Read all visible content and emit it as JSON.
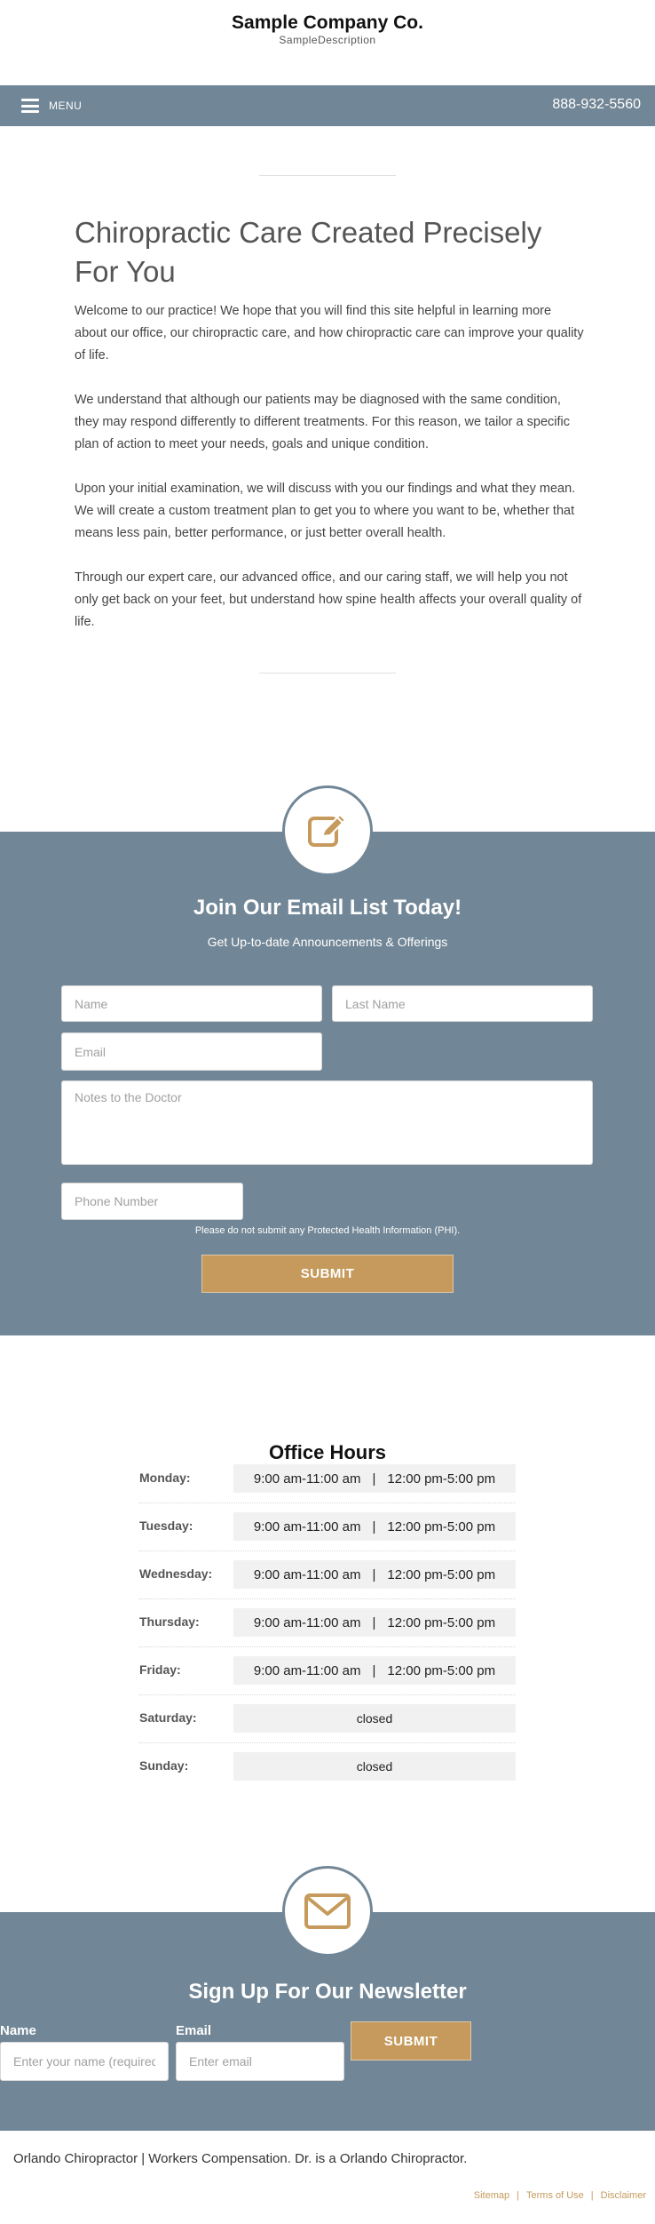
{
  "header": {
    "company_name": "Sample Company Co.",
    "tagline": "SampleDescription"
  },
  "nav": {
    "menu_label": "MENU",
    "phone": "888-932-5560"
  },
  "intro": {
    "title": "Chiropractic Care Created Precisely For You",
    "paragraphs": [
      "Welcome to our practice! We hope that you will find this site helpful in learning more about our office, our chiropractic care, and how chiropractic care can improve your quality of life.",
      "We understand that although our patients may be diagnosed with the same condition, they may respond differently to different treatments. For this reason, we tailor a specific plan of action to meet your needs, goals and unique condition.",
      "Upon your initial examination, we will discuss with you our findings and what they mean. We will create a custom treatment plan to get you to where you want to be, whether that means less pain, better performance, or just better overall health.",
      "Through our expert care, our advanced office, and our caring staff, we will help you not only get back on your feet, but understand how spine health affects your overall quality of life."
    ]
  },
  "email_list": {
    "icon": "edit-pencil-icon",
    "title": "Join Our Email List Today!",
    "subtitle": "Get Up-to-date Announcements & Offerings",
    "placeholders": {
      "name": "Name",
      "last_name": "Last Name",
      "email": "Email",
      "notes": "Notes to the Doctor",
      "phone": "Phone Number"
    },
    "phi_notice": "Please do not submit any Protected Health Information (PHI).",
    "submit_label": "SUBMIT"
  },
  "office_hours": {
    "title": "Office Hours",
    "days": [
      {
        "day": "Monday:",
        "morning": "9:00 am-11:00 am",
        "sep": "|",
        "afternoon": "12:00 pm-5:00 pm"
      },
      {
        "day": "Tuesday:",
        "morning": "9:00 am-11:00 am",
        "sep": "|",
        "afternoon": "12:00 pm-5:00 pm"
      },
      {
        "day": "Wednesday:",
        "morning": "9:00 am-11:00 am",
        "sep": "|",
        "afternoon": "12:00 pm-5:00 pm"
      },
      {
        "day": "Thursday:",
        "morning": "9:00 am-11:00 am",
        "sep": "|",
        "afternoon": "12:00 pm-5:00 pm"
      },
      {
        "day": "Friday:",
        "morning": "9:00 am-11:00 am",
        "sep": "|",
        "afternoon": "12:00 pm-5:00 pm"
      },
      {
        "day": "Saturday:",
        "status": "closed"
      },
      {
        "day": "Sunday:",
        "status": "closed"
      }
    ]
  },
  "newsletter": {
    "icon": "envelope-icon",
    "title": "Sign Up For Our Newsletter",
    "name_label": "Name",
    "name_placeholder": "Enter your name (required)",
    "email_label": "Email",
    "email_placeholder": "Enter email",
    "submit_label": "SUBMIT"
  },
  "footer": {
    "text": "Orlando Chiropractor | Workers Compensation. Dr. is a Orlando Chiropractor.",
    "links": [
      "Sitemap",
      "Terms of Use",
      "Disclaimer"
    ],
    "separator": "|"
  },
  "colors": {
    "slate": "#718696",
    "gold": "#c69a5c"
  }
}
